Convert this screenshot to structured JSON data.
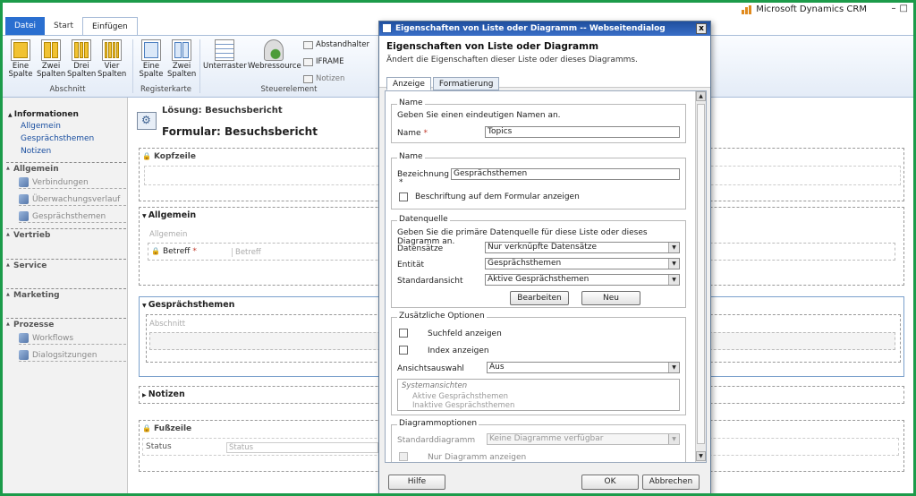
{
  "app": {
    "title": "Microsoft Dynamics CRM"
  },
  "tabs": [
    "Datei",
    "Start",
    "Einfügen"
  ],
  "ribbon": {
    "buttons": [
      {
        "l1": "Eine",
        "l2": "Spalte"
      },
      {
        "l1": "Zwei",
        "l2": "Spalten"
      },
      {
        "l1": "Drei",
        "l2": "Spalten"
      },
      {
        "l1": "Vier",
        "l2": "Spalten"
      },
      {
        "l1": "Eine",
        "l2": "Spalte"
      },
      {
        "l1": "Zwei",
        "l2": "Spalten"
      },
      {
        "l1": "Unterraster",
        "l2": ""
      },
      {
        "l1": "Webressource",
        "l2": ""
      }
    ],
    "small": [
      "Abstandhalter",
      "IFRAME",
      "Notizen"
    ],
    "groups": [
      "Abschnitt",
      "Registerkarte",
      "Steuerelement"
    ]
  },
  "leftnav": {
    "heading": "Informationen",
    "links": [
      "Allgemein",
      "Gesprächsthemen",
      "Notizen"
    ],
    "sections": [
      "Allgemein",
      "Vertrieb",
      "Service",
      "Marketing",
      "Prozesse"
    ],
    "allgemein_items": [
      "Verbindungen",
      "Überwachungsverlauf",
      "Gesprächsthemen"
    ],
    "prozesse_items": [
      "Workflows",
      "Dialogsitzungen"
    ]
  },
  "form": {
    "solution": "Lösung: Besuchsbericht",
    "title": "Formular: Besuchsbericht",
    "header_label": "Kopfzeile",
    "tab_allgemein": "Allgemein",
    "allgemein_section": "Allgemein",
    "betreff_label": "Betreff",
    "betreff_req": "*",
    "betreff_ph": "Betreff",
    "tab_gespraech": "Gesprächsthemen",
    "abschnitt": "Abschnitt",
    "tab_notizen": "Notizen",
    "footer_label": "Fußzeile",
    "status_label": "Status",
    "status_ph": "Status"
  },
  "dialog": {
    "titlebar": "Eigenschaften von Liste oder Diagramm -- Webseitendialog",
    "close": "x",
    "heading": "Eigenschaften von Liste oder Diagramm",
    "subheading": "Ändert die Eigenschaften dieser Liste oder dieses Diagramms.",
    "tabs": [
      "Anzeige",
      "Formatierung"
    ],
    "name_group": {
      "legend": "Name",
      "hint": "Geben Sie einen eindeutigen Namen an.",
      "label": "Name",
      "req": "*",
      "value": "Topics"
    },
    "label_group": {
      "legend": "Name",
      "label": "Bezeichnung",
      "req": "*",
      "value": "Gesprächsthemen",
      "checkbox": "Beschriftung auf dem Formular anzeigen"
    },
    "source_group": {
      "legend": "Datenquelle",
      "hint": "Geben Sie die primäre Datenquelle für diese Liste oder dieses Diagramm an.",
      "records_label": "Datensätze",
      "records_value": "Nur verknüpfte Datensätze",
      "entity_label": "Entität",
      "entity_value": "Gesprächsthemen",
      "view_label": "Standardansicht",
      "view_value": "Aktive Gesprächsthemen",
      "edit": "Bearbeiten",
      "new": "Neu"
    },
    "options_group": {
      "legend": "Zusätzliche Optionen",
      "search": "Suchfeld anzeigen",
      "index": "Index anzeigen",
      "viewsel_label": "Ansichtsauswahl",
      "viewsel_value": "Aus",
      "list_heading": "Systemansichten",
      "list_items": [
        "Aktive Gesprächsthemen",
        "Inaktive Gesprächsthemen"
      ]
    },
    "chart_group": {
      "legend": "Diagrammoptionen",
      "label": "Standarddiagramm",
      "value": "Keine Diagramme verfügbar",
      "only": "Nur Diagramm anzeigen"
    },
    "footer": {
      "help": "Hilfe",
      "ok": "OK",
      "cancel": "Abbrechen"
    }
  }
}
